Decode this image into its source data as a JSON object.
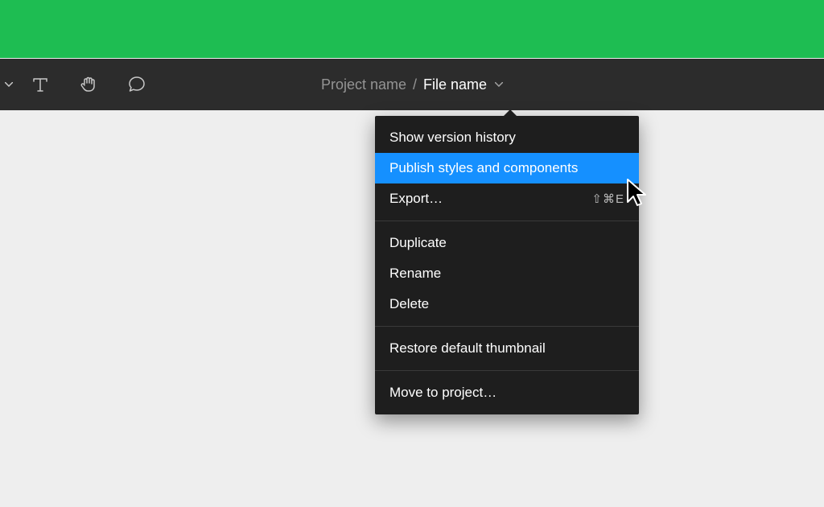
{
  "colors": {
    "green_bar": "#1ebd52",
    "toolbar": "#2c2c2c",
    "dropdown_bg": "#1e1e1e",
    "selected": "#1590ff",
    "canvas": "#eeeeee"
  },
  "title": {
    "project": "Project name",
    "separator": "/",
    "file": "File name"
  },
  "menu": {
    "show_version_history": "Show version history",
    "publish": "Publish styles and components",
    "export": "Export…",
    "export_shortcut": "⇧⌘E",
    "duplicate": "Duplicate",
    "rename": "Rename",
    "delete": "Delete",
    "restore_thumbnail": "Restore default thumbnail",
    "move_to_project": "Move to project…"
  }
}
